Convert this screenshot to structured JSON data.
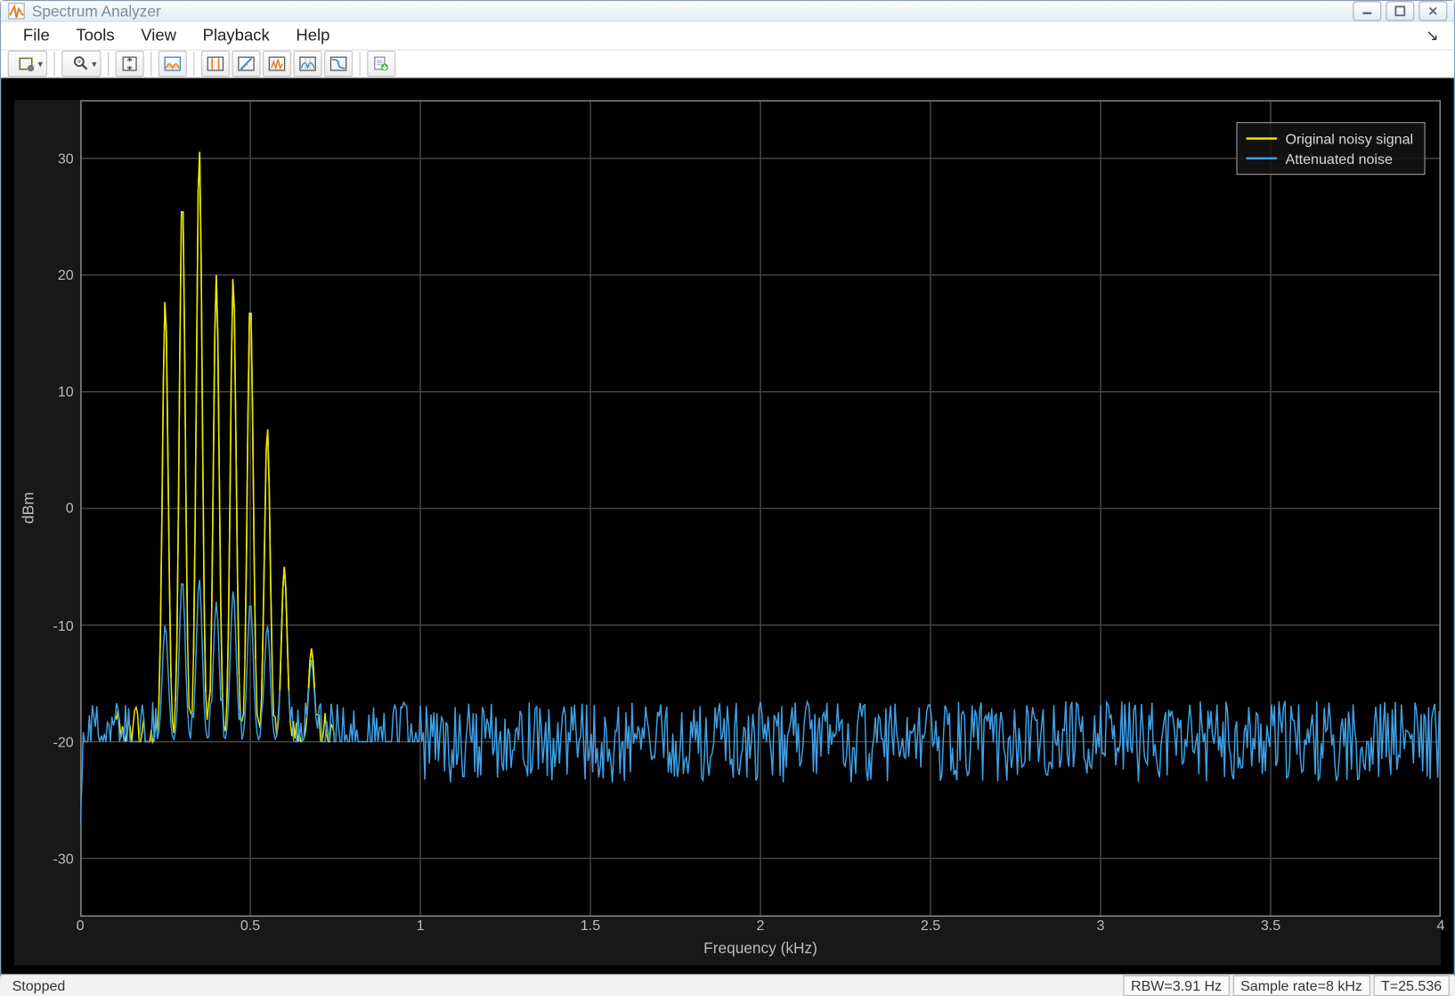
{
  "window": {
    "title": "Spectrum Analyzer"
  },
  "menu": {
    "file": "File",
    "tools": "Tools",
    "view": "View",
    "playback": "Playback",
    "help": "Help"
  },
  "toolbar": {
    "settings": "settings",
    "zoom": "zoom",
    "autoscale": "autoscale",
    "spectrum": "spectrum",
    "cursor": "cursor",
    "measure": "measure",
    "peaks": "peaks",
    "ccdf": "ccdf",
    "mask": "mask",
    "export": "export"
  },
  "legend": {
    "series1": "Original noisy signal",
    "series2": "Attenuated noise"
  },
  "axes": {
    "ylabel": "dBm",
    "xlabel": "Frequency (kHz)"
  },
  "status": {
    "state": "Stopped",
    "rbw": "RBW=3.91 Hz",
    "rate": "Sample rate=8 kHz",
    "time": "T=25.536"
  },
  "chart_data": {
    "type": "line",
    "xlabel": "Frequency (kHz)",
    "ylabel": "dBm",
    "xlim": [
      0,
      4
    ],
    "ylim": [
      -35,
      35
    ],
    "xticks": [
      0,
      0.5,
      1,
      1.5,
      2,
      2.5,
      3,
      3.5,
      4
    ],
    "yticks": [
      -30,
      -20,
      -10,
      0,
      10,
      20,
      30
    ],
    "series": [
      {
        "name": "Original noisy signal",
        "color": "#e8e800",
        "noise_floor_db": -20,
        "noise_amp_db": 3,
        "noise_xrange": [
          0.1,
          0.75
        ],
        "peaks": [
          {
            "x": 0.25,
            "y": 18
          },
          {
            "x": 0.3,
            "y": 27
          },
          {
            "x": 0.35,
            "y": 31
          },
          {
            "x": 0.4,
            "y": 20
          },
          {
            "x": 0.45,
            "y": 20
          },
          {
            "x": 0.5,
            "y": 18
          },
          {
            "x": 0.55,
            "y": 7
          },
          {
            "x": 0.6,
            "y": -5
          },
          {
            "x": 0.68,
            "y": -12
          }
        ]
      },
      {
        "name": "Attenuated noise",
        "color": "#3fa0e6",
        "noise_floor_db": -20,
        "noise_amp_db": 3.5,
        "noise_xrange": [
          0,
          4
        ],
        "peaks": [
          {
            "x": 0.25,
            "y": -10
          },
          {
            "x": 0.3,
            "y": -6
          },
          {
            "x": 0.35,
            "y": -6
          },
          {
            "x": 0.4,
            "y": -8
          },
          {
            "x": 0.45,
            "y": -7
          },
          {
            "x": 0.5,
            "y": -8
          },
          {
            "x": 0.55,
            "y": -10
          },
          {
            "x": 0.6,
            "y": -5
          },
          {
            "x": 0.68,
            "y": -13
          }
        ]
      }
    ]
  }
}
